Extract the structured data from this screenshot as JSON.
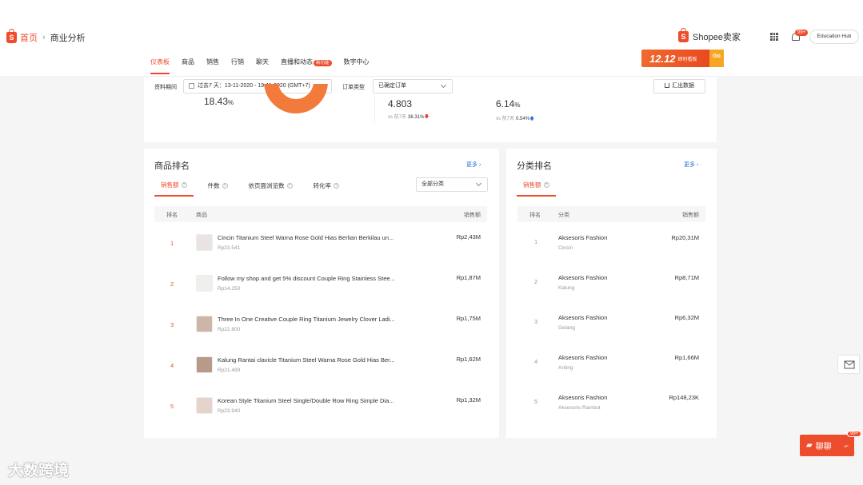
{
  "breadcrumb": {
    "home": "首页",
    "current": "商业分析"
  },
  "brand": {
    "name": "Shopee卖家",
    "logo_letter": "S"
  },
  "header": {
    "notif_count": "99+",
    "education_hub": "Education Hub"
  },
  "nav_tabs": [
    {
      "label": "仪表板",
      "active": true
    },
    {
      "label": "商品"
    },
    {
      "label": "销售"
    },
    {
      "label": "行销"
    },
    {
      "label": "聊天"
    },
    {
      "label": "直播和动态",
      "badge": "新功能"
    },
    {
      "label": "数字中心"
    }
  ],
  "promo": {
    "title": "12.12",
    "subtitle": "即时看板",
    "go": "Go"
  },
  "filters": {
    "period_label": "资料期间",
    "period_value": "过去7 天：13-11-2020 - 19-11-2020 (GMT+7)",
    "order_type_label": "订单类型",
    "order_type_value": "已确定订单",
    "export_label": "汇出数据"
  },
  "metrics": {
    "m1": {
      "value": "18.43",
      "unit": "%"
    },
    "m2": {
      "value": "4.803",
      "vs_label": "vs 前7天",
      "change": "36.31%"
    },
    "m3": {
      "value": "6.14",
      "unit": "%",
      "vs_label": "vs 前7天",
      "change": "0.54%"
    }
  },
  "product_ranking": {
    "title": "商品排名",
    "more": "更多",
    "tabs": [
      "销售额",
      "件数",
      "依页面浏览数",
      "转化率"
    ],
    "category_select": "全部分类",
    "columns": {
      "rank": "排名",
      "product": "商品",
      "sales": "销售额"
    },
    "rows": [
      {
        "rank": "1",
        "name": "Cincin Titanium Steel Warna Rose Gold Hias Berlian Berkilau un...",
        "price": "Rp23.541",
        "sales": "Rp2,43M"
      },
      {
        "rank": "2",
        "name": "Follow my shop and get 5% discount Couple Ring Stainless Stee...",
        "price": "Rp14.250",
        "sales": "Rp1,87M"
      },
      {
        "rank": "3",
        "name": "Three In One Creative Couple Ring Titanium Jewelry Clover Ladi...",
        "price": "Rp22.800",
        "sales": "Rp1,75M"
      },
      {
        "rank": "4",
        "name": "Kalung Rantai clavicle Titanium Steel Warna Rose Gold Hias Ber...",
        "price": "Rp21.489",
        "sales": "Rp1,62M"
      },
      {
        "rank": "5",
        "name": "Korean Style Titanium Steel Single/Double Row Ring Simple Dia...",
        "price": "Rp23.940",
        "sales": "Rp1,32M"
      }
    ]
  },
  "category_ranking": {
    "title": "分类排名",
    "more": "更多",
    "tab": "销售额",
    "columns": {
      "rank": "排名",
      "category": "分类",
      "sales": "销售额"
    },
    "rows": [
      {
        "rank": "1",
        "name": "Aksesoris Fashion",
        "sub": "Cincin",
        "sales": "Rp20,31M"
      },
      {
        "rank": "2",
        "name": "Aksesoris Fashion",
        "sub": "Kalung",
        "sales": "Rp8,71M"
      },
      {
        "rank": "3",
        "name": "Aksesoris Fashion",
        "sub": "Gelang",
        "sales": "Rp6,32M"
      },
      {
        "rank": "4",
        "name": "Aksesoris Fashion",
        "sub": "Anting",
        "sales": "Rp1,66M"
      },
      {
        "rank": "5",
        "name": "Aksesoris Fashion",
        "sub": "Aksesoris Rambut",
        "sales": "Rp148,23K"
      }
    ]
  },
  "chat": {
    "label": "聊聊",
    "badge": "99+"
  },
  "watermark": "大数跨境",
  "colors": {
    "accent": "#ee4d2d",
    "link": "#2673dd",
    "down": "#e53935",
    "up": "#2673dd"
  }
}
